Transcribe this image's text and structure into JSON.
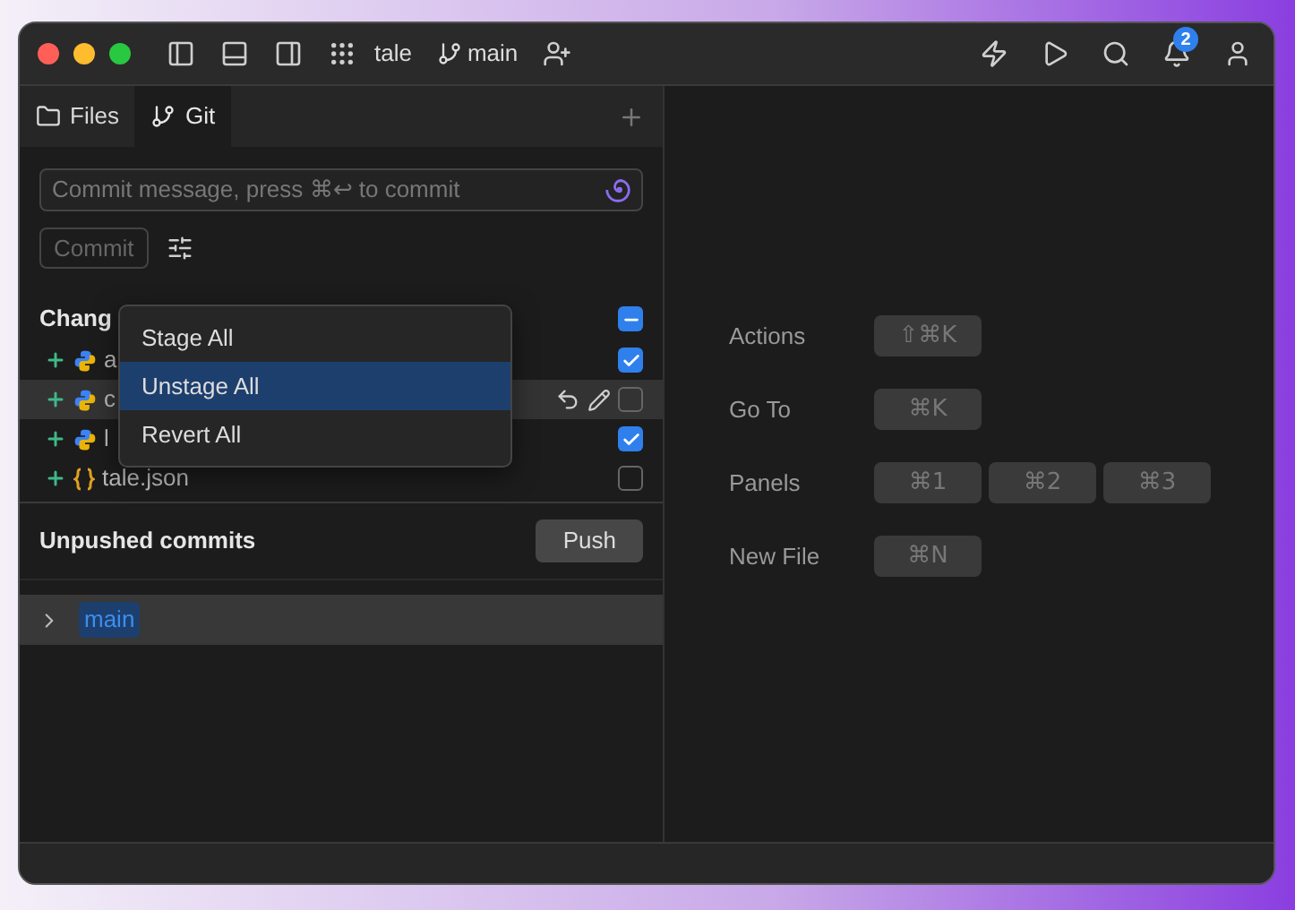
{
  "window": {
    "project": "tale",
    "branch": "main",
    "notifications": "2"
  },
  "tabs": [
    {
      "label": "Files",
      "selected": false,
      "kind": "folder"
    },
    {
      "label": "Git",
      "selected": true,
      "kind": "branch"
    }
  ],
  "commit": {
    "placeholder": "Commit message, press ⌘↩ to commit",
    "button": "Commit"
  },
  "changes": {
    "heading": "Chang",
    "checked": true,
    "mixed": true,
    "files": [
      {
        "name": "a",
        "kind": "python",
        "checked": true,
        "hovered": false
      },
      {
        "name": "c",
        "kind": "python",
        "checked": false,
        "hovered": true
      },
      {
        "name": "l",
        "kind": "python",
        "checked": true,
        "hovered": false
      },
      {
        "name": "tale.json",
        "kind": "json",
        "checked": false,
        "hovered": false
      }
    ]
  },
  "menu": {
    "items": [
      {
        "label": "Stage All",
        "selected": false
      },
      {
        "label": "Unstage All",
        "selected": true
      },
      {
        "label": "Revert All",
        "selected": false
      }
    ]
  },
  "unpushed": {
    "heading": "Unpushed commits",
    "button": "Push",
    "branches": [
      {
        "name": "main",
        "expanded": false
      }
    ]
  },
  "shortcuts": [
    {
      "label": "Actions",
      "keys": [
        "⇧⌘K"
      ]
    },
    {
      "label": "Go To",
      "keys": [
        "⌘K"
      ]
    },
    {
      "label": "Panels",
      "keys": [
        "⌘1",
        "⌘2",
        "⌘3"
      ]
    },
    {
      "label": "New File",
      "keys": [
        "⌘N"
      ]
    }
  ]
}
